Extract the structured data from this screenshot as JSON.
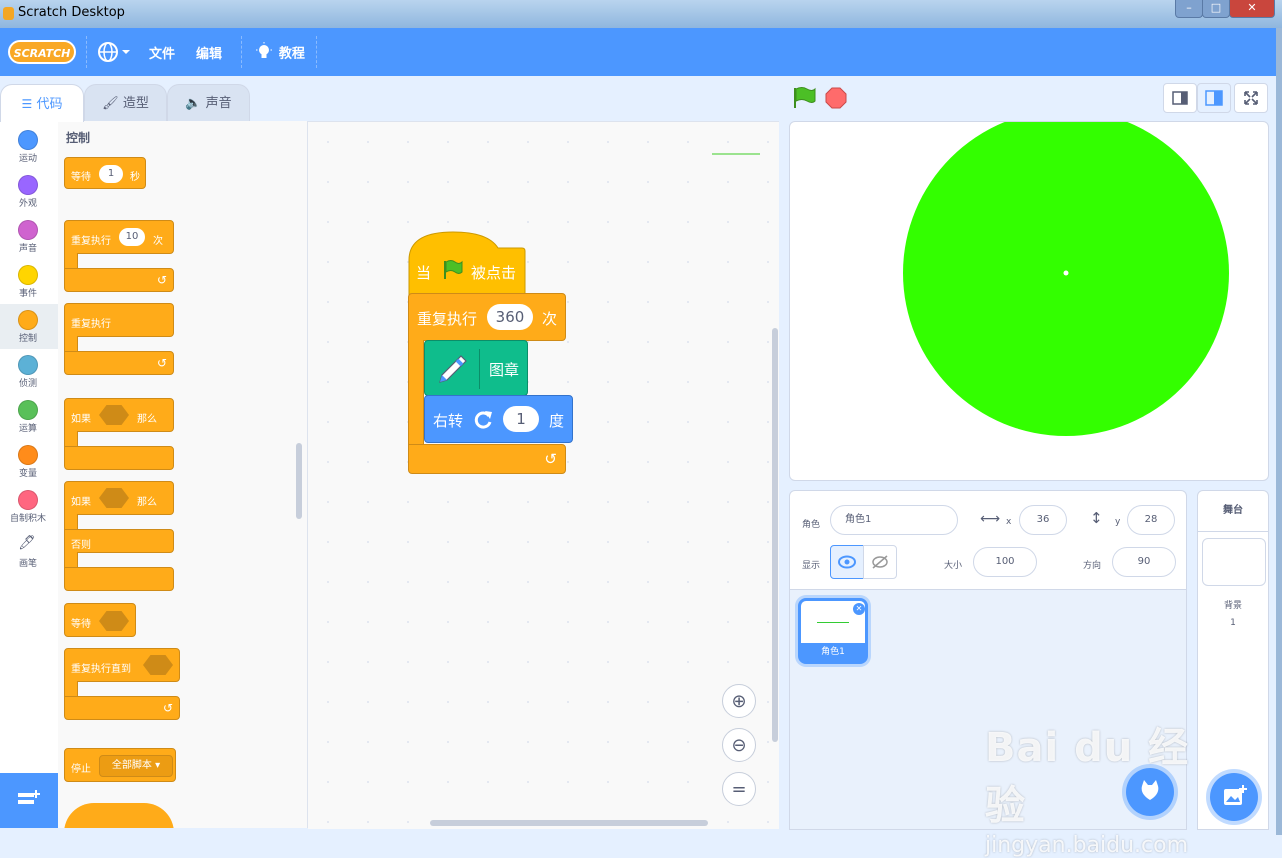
{
  "window": {
    "title": "Scratch Desktop",
    "minimize": "–",
    "maximize": "□",
    "close": "✕"
  },
  "menubar": {
    "logo": "SCRATCH",
    "file": "文件",
    "edit": "编辑",
    "tutorials": "教程"
  },
  "tabs": {
    "code": "代码",
    "costumes": "造型",
    "sounds": "声音"
  },
  "categories": [
    {
      "label": "运动",
      "color": "#4c97ff"
    },
    {
      "label": "外观",
      "color": "#9966ff"
    },
    {
      "label": "声音",
      "color": "#cf63cf"
    },
    {
      "label": "事件",
      "color": "#ffd500"
    },
    {
      "label": "控制",
      "color": "#ffab19"
    },
    {
      "label": "侦测",
      "color": "#5cb1d6"
    },
    {
      "label": "运算",
      "color": "#59c059"
    },
    {
      "label": "变量",
      "color": "#ff8c1a"
    },
    {
      "label": "自制积木",
      "color": "#ff6680"
    },
    {
      "label": "画笔",
      "color": "#0fbd8c"
    }
  ],
  "palette": {
    "heading": "控制",
    "wait": "等待",
    "wait_value": "1",
    "wait_unit": "秒",
    "repeat": "重复执行",
    "repeat_value": "10",
    "repeat_unit": "次",
    "forever": "重复执行",
    "if": "如果",
    "then": "那么",
    "if2": "如果",
    "then2": "那么",
    "else": "否则",
    "wait_until": "等待",
    "repeat_until": "重复执行直到",
    "stop": "停止",
    "stop_option": "全部脚本"
  },
  "script": {
    "hat_when": "当",
    "hat_clicked": "被点击",
    "repeat": "重复执行",
    "repeat_value": "360",
    "repeat_unit": "次",
    "stamp": "图章",
    "turn": "右转",
    "turn_value": "1",
    "turn_unit": "度"
  },
  "sprite_info": {
    "sprite_label": "角色",
    "sprite_name": "角色1",
    "x_label": "x",
    "x_value": "36",
    "y_label": "y",
    "y_value": "28",
    "show_label": "显示",
    "size_label": "大小",
    "size_value": "100",
    "direction_label": "方向",
    "direction_value": "90"
  },
  "sprites": [
    {
      "name": "角色1"
    }
  ],
  "stage_panel": {
    "title": "舞台",
    "backdrops_label": "背景",
    "backdrops_count": "1"
  },
  "watermark": {
    "brand": "Bai du 经验",
    "url": "jingyan.baidu.com"
  },
  "colors": {
    "accent": "#4c97ff",
    "control": "#ffab19",
    "events": "#ffbf00",
    "pen": "#0fbd8c",
    "motion": "#4c97ff",
    "stage_circle": "#33ff00"
  }
}
